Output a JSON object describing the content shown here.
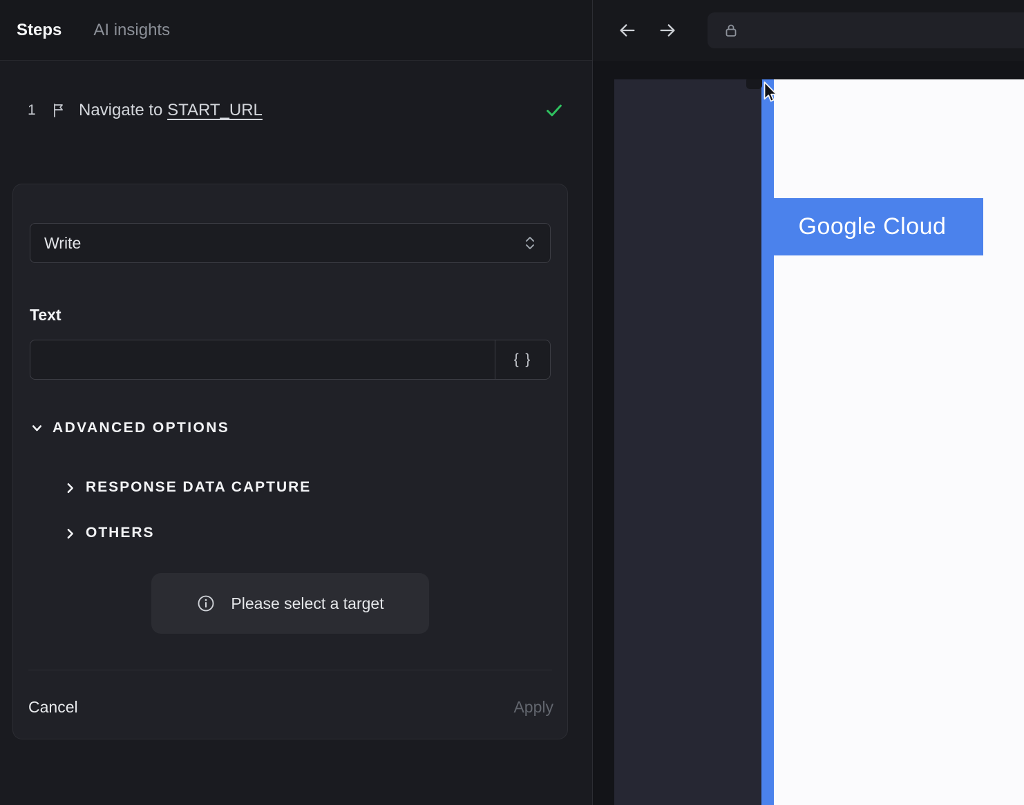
{
  "left_panel": {
    "tabs": [
      {
        "label": "Steps",
        "active": true
      },
      {
        "label": "AI insights",
        "active": false
      }
    ],
    "step": {
      "number": "1",
      "label": "Navigate to",
      "link": "START_URL",
      "status": "success"
    },
    "editor": {
      "action_value": "Write",
      "text_label": "Text",
      "text_value": "",
      "insert_variable_label": "{ }",
      "advanced_options_label": "ADVANCED OPTIONS",
      "response_data_capture_label": "RESPONSE DATA CAPTURE",
      "others_label": "OTHERS",
      "notice": "Please select a target",
      "cancel_label": "Cancel",
      "apply_label": "Apply"
    }
  },
  "browser": {
    "url_value": "",
    "page_label": "Google Cloud"
  },
  "colors": {
    "accent_blue": "#4b82ec",
    "success_green": "#2fc15f",
    "panel_dark": "#1a1b20",
    "card_dark": "#202127"
  }
}
